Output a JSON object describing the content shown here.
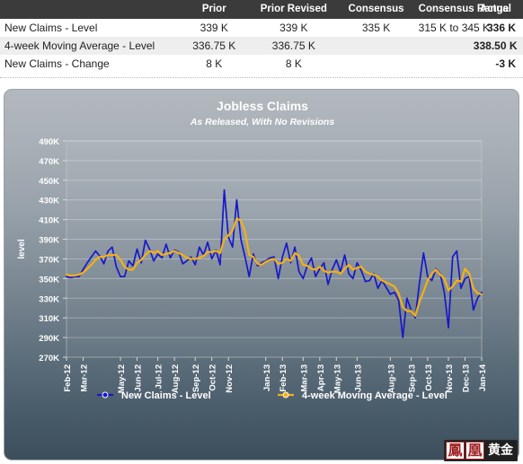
{
  "table": {
    "columns": [
      "",
      "Prior",
      "Prior Revised",
      "Consensus",
      "Consensus Range",
      "Actual"
    ],
    "rows": [
      {
        "metric": "New Claims - Level",
        "prior": "339 K",
        "prior_revised": "339 K",
        "consensus": "335 K",
        "consensus_range": "315 K to 345 K",
        "actual": "336 K"
      },
      {
        "metric": "4-week Moving Average - Level",
        "prior": "336.75 K",
        "prior_revised": "336.75 K",
        "consensus": "",
        "consensus_range": "",
        "actual": "338.50 K"
      },
      {
        "metric": "New Claims - Change",
        "prior": "8 K",
        "prior_revised": "8 K",
        "consensus": "",
        "consensus_range": "",
        "actual": "-3 K"
      }
    ]
  },
  "watermark": {
    "char1": "鳳",
    "char2": "凰",
    "gold": "黄金"
  },
  "chart_data": {
    "type": "line",
    "title": "Jobless Claims",
    "subtitle": "As Released, With No Revisions",
    "xlabel": "",
    "ylabel": "level",
    "ylim": [
      270,
      490
    ],
    "ytick_step": 20,
    "ytick_labels": [
      "490K",
      "470K",
      "450K",
      "430K",
      "410K",
      "390K",
      "370K",
      "350K",
      "330K",
      "310K",
      "290K",
      "270K"
    ],
    "yticks": [
      490,
      470,
      450,
      430,
      410,
      390,
      370,
      350,
      330,
      310,
      290,
      270
    ],
    "grid": true,
    "legend_position": "bottom",
    "unit": "K",
    "xtick_labels": [
      "Feb-12",
      "Mar-12",
      "May-12",
      "Jun-12",
      "Jul-12",
      "Aug-12",
      "Sep-12",
      "Oct-12",
      "Nov-12",
      "Jan-13",
      "Feb-13",
      "Mar-13",
      "Apr-13",
      "May-13",
      "Jun-13",
      "Aug-13",
      "Sep-13",
      "Oct-13",
      "Nov-13",
      "Dec-13",
      "Jan-14"
    ],
    "xtick_indices": [
      0,
      4,
      13,
      17,
      22,
      26,
      31,
      35,
      39,
      48,
      52,
      57,
      61,
      65,
      70,
      78,
      83,
      87,
      92,
      96,
      100
    ],
    "series": [
      {
        "name": "New Claims - Level",
        "color": "#1818c8",
        "marker_color": "#1818c8",
        "values": [
          352,
          351,
          352,
          352,
          359,
          366,
          372,
          378,
          373,
          365,
          378,
          382,
          362,
          352,
          352,
          368,
          363,
          380,
          366,
          389,
          380,
          368,
          375,
          371,
          385,
          371,
          379,
          377,
          365,
          368,
          372,
          364,
          382,
          374,
          387,
          370,
          379,
          364,
          440,
          392,
          382,
          430,
          390,
          372,
          352,
          375,
          363,
          366,
          368,
          371,
          372,
          350,
          372,
          386,
          366,
          382,
          357,
          350,
          363,
          371,
          352,
          360,
          366,
          344,
          359,
          369,
          357,
          374,
          355,
          350,
          366,
          358,
          347,
          348,
          355,
          340,
          348,
          341,
          334,
          336,
          328,
          290,
          330,
          318,
          310,
          345,
          376,
          352,
          348,
          360,
          355,
          336,
          300,
          372,
          378,
          340,
          350,
          352,
          318,
          330,
          336
        ]
      },
      {
        "name": "4-week Moving Average - Level",
        "color": "#f5b014",
        "marker_color": "#f5b014",
        "values": [
          354,
          353,
          353,
          354,
          356,
          360,
          364,
          369,
          372,
          372,
          374,
          374,
          374,
          369,
          362,
          359,
          359,
          366,
          369,
          374,
          378,
          376,
          378,
          374,
          375,
          376,
          378,
          376,
          374,
          371,
          370,
          370,
          371,
          373,
          377,
          377,
          378,
          376,
          390,
          394,
          399,
          411,
          409,
          398,
          374,
          372,
          365,
          364,
          367,
          369,
          370,
          365,
          366,
          370,
          368,
          376,
          373,
          364,
          363,
          360,
          359,
          362,
          358,
          356,
          357,
          357,
          355,
          360,
          364,
          359,
          361,
          362,
          357,
          355,
          354,
          352,
          348,
          346,
          344,
          342,
          335,
          321,
          317,
          317,
          312,
          326,
          337,
          348,
          355,
          359,
          354,
          350,
          338,
          342,
          348,
          347,
          360,
          355,
          340,
          335,
          334
        ]
      }
    ]
  }
}
